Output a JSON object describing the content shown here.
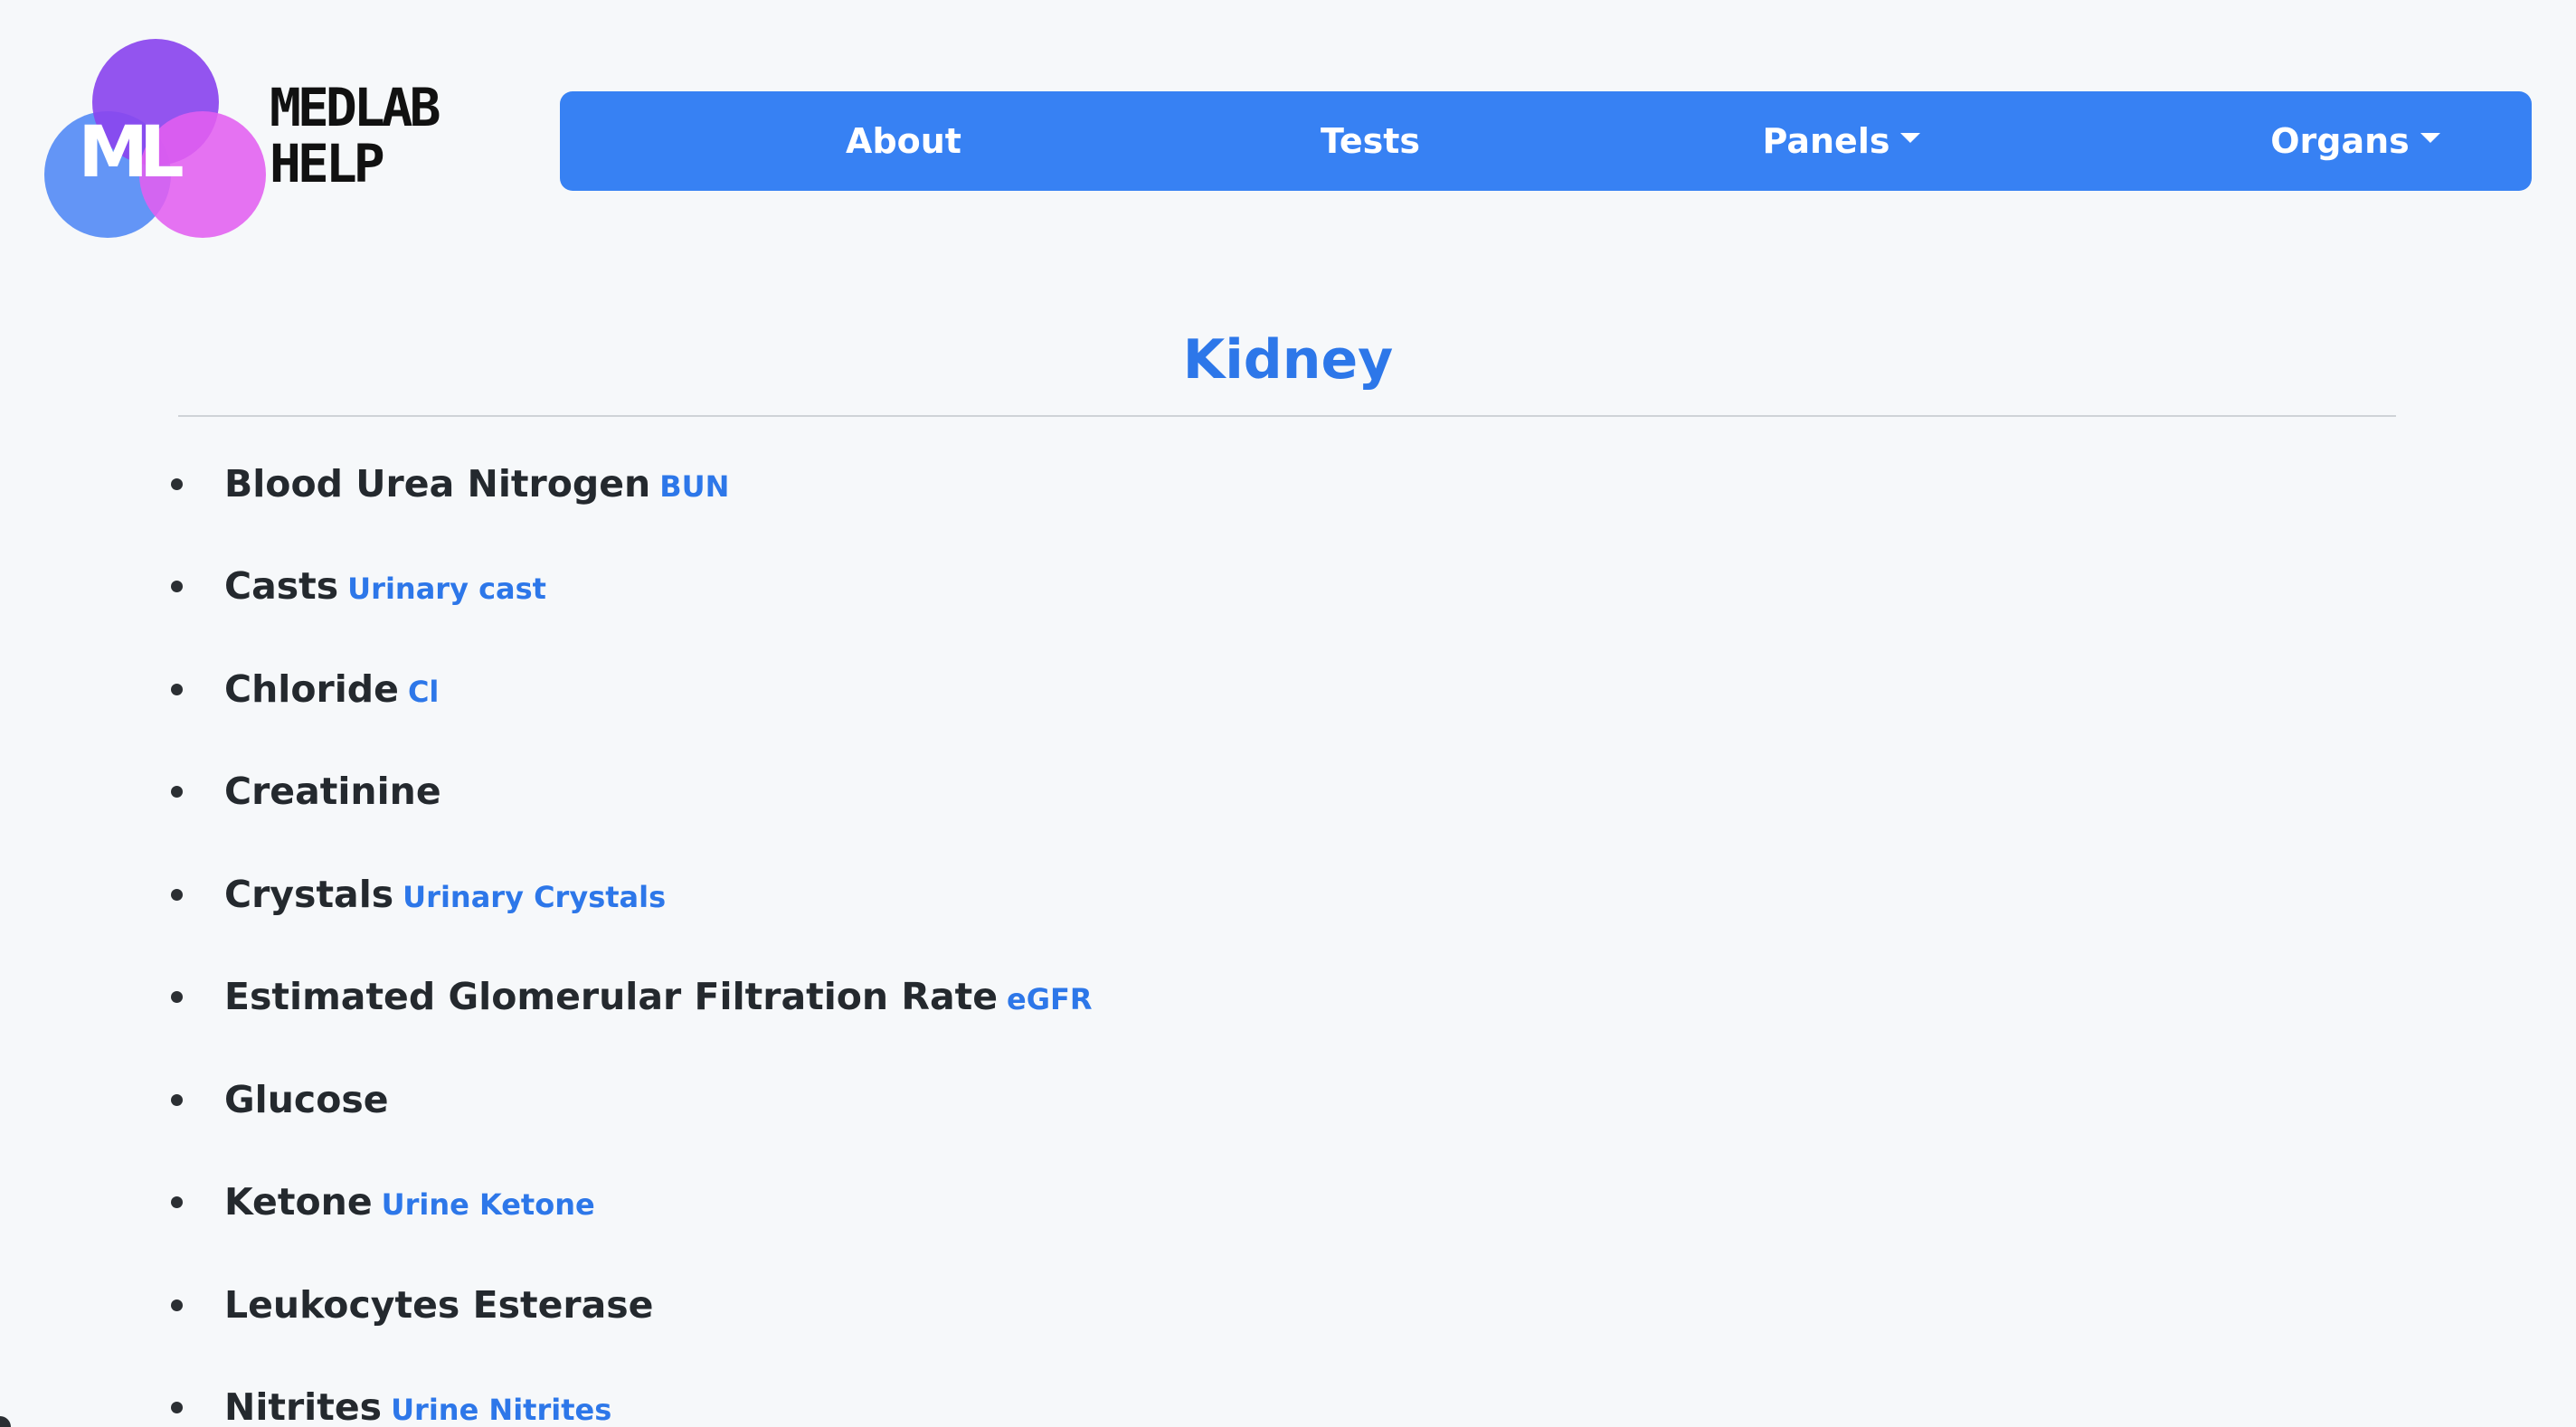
{
  "logo": {
    "monogram": "ML",
    "line1": "MEDLAB",
    "line2": "HELP"
  },
  "nav": {
    "about": "About",
    "tests": "Tests",
    "panels": "Panels",
    "organs": "Organs"
  },
  "page": {
    "title": "Kidney"
  },
  "items": [
    {
      "name": "Blood Urea Nitrogen",
      "abbr": "BUN"
    },
    {
      "name": "Casts",
      "abbr": "Urinary cast"
    },
    {
      "name": "Chloride",
      "abbr": "Cl"
    },
    {
      "name": "Creatinine",
      "abbr": ""
    },
    {
      "name": "Crystals",
      "abbr": "Urinary Crystals"
    },
    {
      "name": "Estimated Glomerular Filtration Rate",
      "abbr": "eGFR"
    },
    {
      "name": "Glucose",
      "abbr": ""
    },
    {
      "name": "Ketone",
      "abbr": "Urine Ketone"
    },
    {
      "name": "Leukocytes Esterase",
      "abbr": ""
    },
    {
      "name": "Nitrites",
      "abbr": "Urine Nitrites"
    }
  ],
  "colors": {
    "background": "#f6f8fa",
    "navbar": "#3781f3",
    "accent": "#2d77e9",
    "text": "#24292e"
  }
}
